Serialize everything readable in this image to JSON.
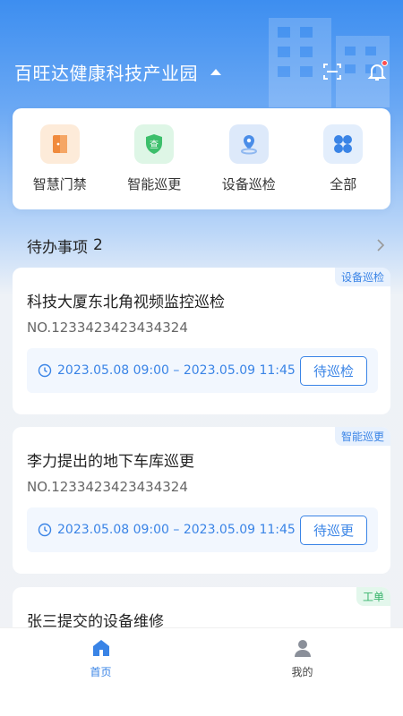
{
  "header": {
    "title": "百旺达健康科技产业园"
  },
  "quick_actions": [
    {
      "label": "智慧门禁",
      "icon": "door-icon"
    },
    {
      "label": "智能巡更",
      "icon": "shield-check-icon"
    },
    {
      "label": "设备巡检",
      "icon": "location-pin-icon"
    },
    {
      "label": "全部",
      "icon": "grid-icon"
    }
  ],
  "todo": {
    "title": "待办事项",
    "count": "2"
  },
  "tasks": [
    {
      "tag": "设备巡检",
      "title": "科技大厦东北角视频监控巡检",
      "no": "NO.1233423423434324",
      "time": "2023.05.08 09:00 – 2023.05.09 11:45",
      "action": "待巡检"
    },
    {
      "tag": "智能巡更",
      "title": "李力提出的地下车库巡更",
      "no": "NO.1233423423434324",
      "time": "2023.05.08 09:00 – 2023.05.09 11:45",
      "action": "待巡更"
    },
    {
      "tag": "工单",
      "title": "张三提交的设备维修"
    }
  ],
  "tabbar": [
    {
      "label": "首页"
    },
    {
      "label": "我的"
    }
  ],
  "colors": {
    "primary": "#3a84e6",
    "tag_green": "#36b36a",
    "badge_red": "#ff4d4f"
  }
}
